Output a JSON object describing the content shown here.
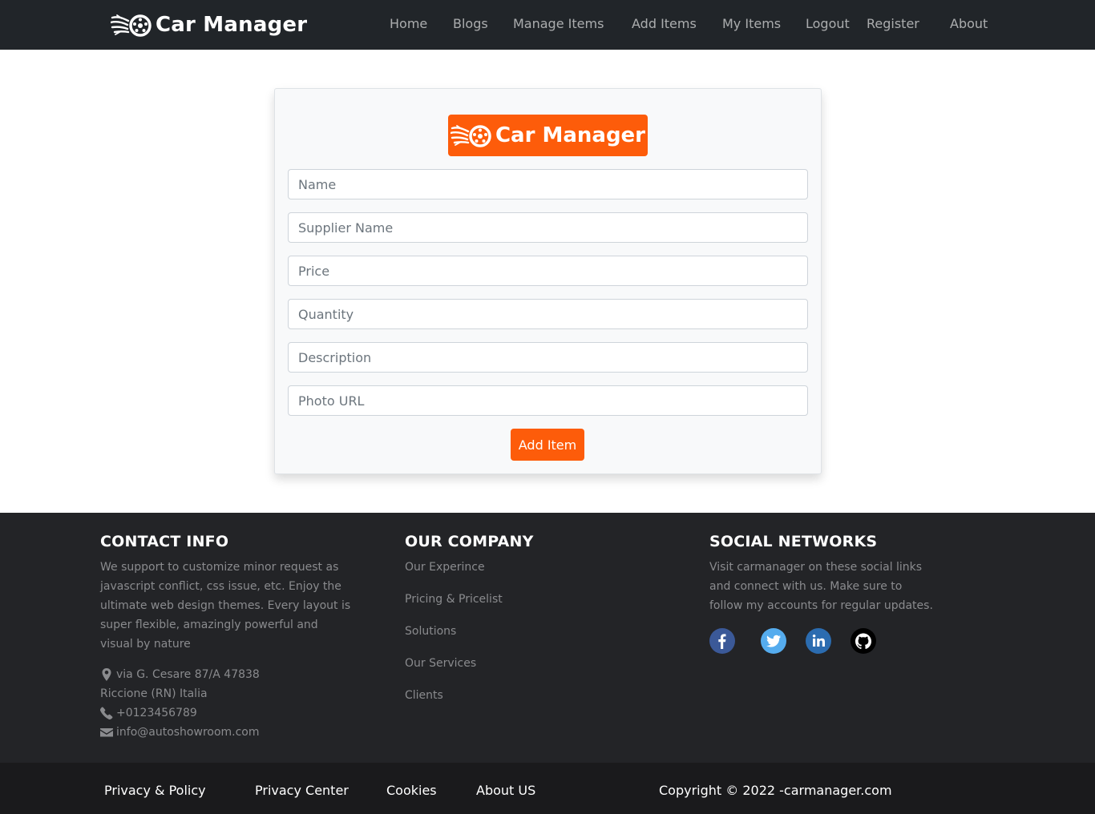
{
  "brand": {
    "name": "Car Manager",
    "accent": "#fd5c0a",
    "logo_icon": "flaming-wheel-icon"
  },
  "nav": {
    "home": "Home",
    "blogs": "Blogs",
    "manage_items": "Manage Items",
    "add_items": "Add Items",
    "my_items": "My Items",
    "logout": "Logout",
    "register": "Register",
    "about": "About"
  },
  "form": {
    "name_placeholder": "Name",
    "supplier_placeholder": "Supplier Name",
    "price_placeholder": "Price",
    "quantity_placeholder": "Quantity",
    "description_placeholder": "Description",
    "photo_placeholder": "Photo URL",
    "submit_label": "Add Item"
  },
  "footer": {
    "contact": {
      "heading": "CONTACT INFO",
      "text_lines": [
        "We support to customize minor request as",
        "javascript conflict, css issue, etc. Enjoy the",
        "ultimate web design themes. Every layout is",
        "super flexible, amazingly powerful and",
        "visual by nature"
      ],
      "address_line1": "via G. Cesare 87/A 47838",
      "address_line2": "Riccione (RN) Italia",
      "phone": "+0123456789",
      "email": "info@autoshowroom.com"
    },
    "company": {
      "heading": "OUR COMPANY",
      "links": [
        "Our Experince",
        "Pricing & Pricelist",
        "Solutions",
        "Our Services",
        "Clients"
      ]
    },
    "social": {
      "heading": "SOCIAL NETWORKS",
      "text_lines": [
        "Visit carmanager on these social links",
        "and connect with us. Make sure to",
        "follow my accounts for regular updates."
      ],
      "icons": [
        {
          "name": "facebook-icon",
          "color": "#3b5998"
        },
        {
          "name": "twitter-icon",
          "color": "#55acee"
        },
        {
          "name": "linkedin-icon",
          "color": "#2b6cb0"
        },
        {
          "name": "github-icon",
          "color": "#000000"
        }
      ]
    }
  },
  "bottom": {
    "privacy_policy": "Privacy & Policy",
    "privacy_center": "Privacy Center",
    "cookies": "Cookies",
    "about_us": "About US",
    "copyright": "Copyright © 2022 -carmanager.com"
  }
}
